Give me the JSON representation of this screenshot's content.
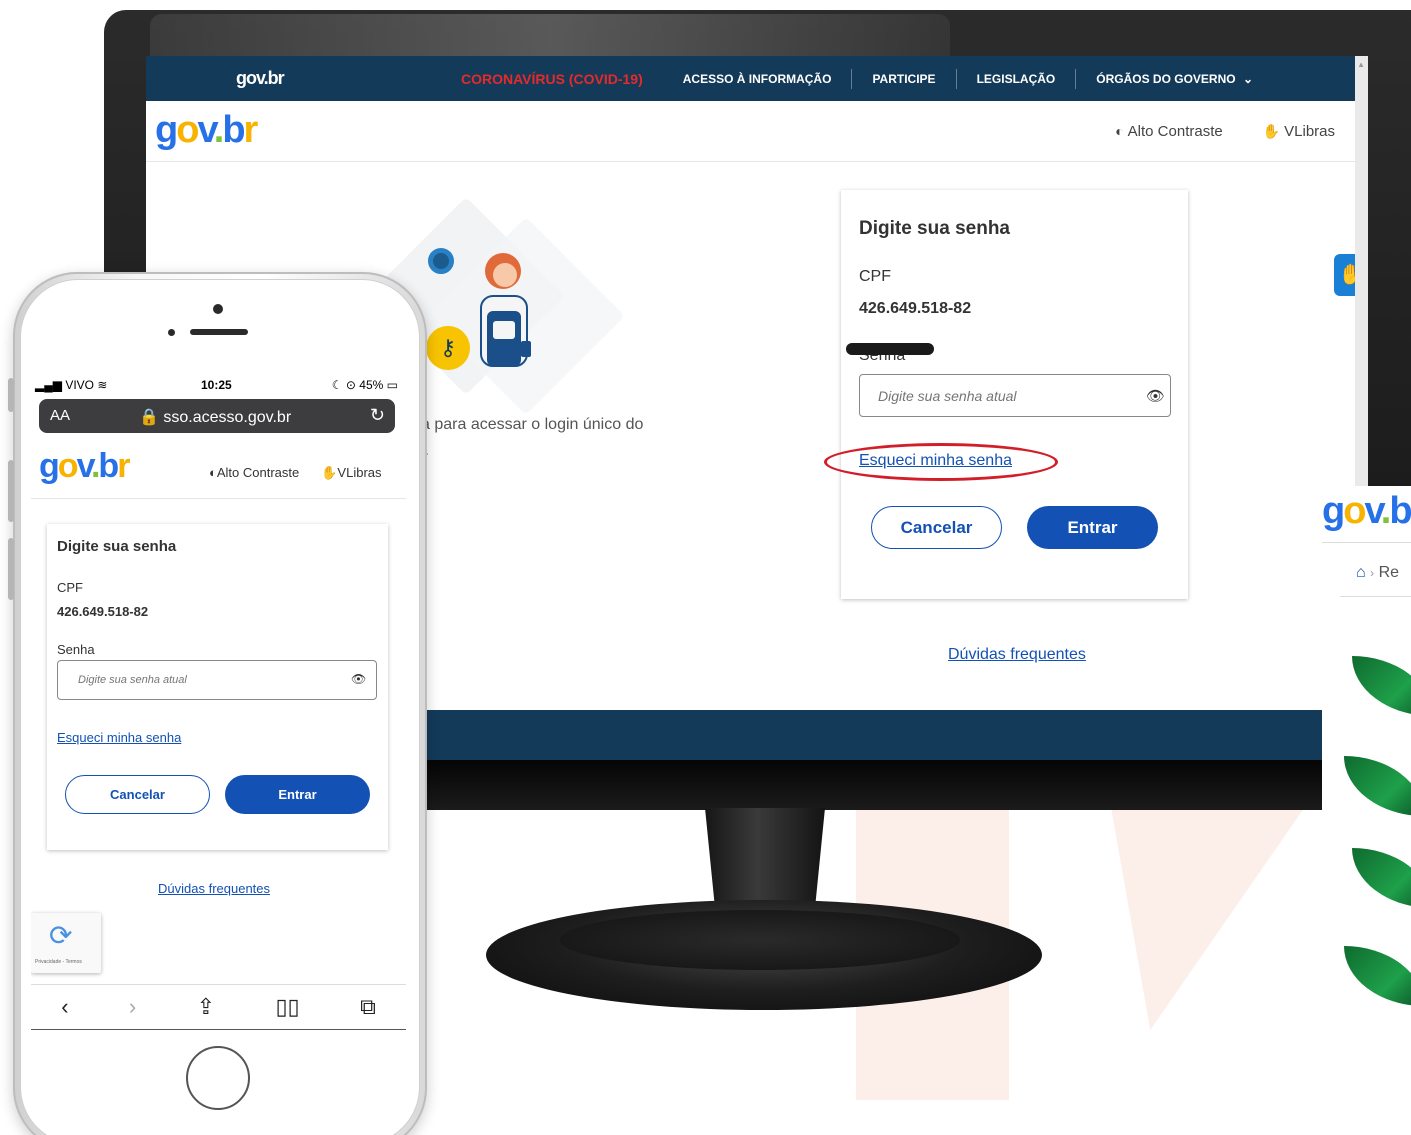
{
  "desktop": {
    "topbar": {
      "brand": "gov.br",
      "nav": [
        "CORONAVÍRUS (COVID-19)",
        "ACESSO À INFORMAÇÃO",
        "PARTICIPE",
        "LEGISLAÇÃO",
        "ÓRGÃOS DO GOVERNO"
      ],
      "dropdown_glyph": "⌄"
    },
    "header": {
      "logo": {
        "g": "g",
        "o": "o",
        "v": "v",
        "dot": ".",
        "b": "b",
        "r": "r"
      },
      "alto_contraste": "Alto Contraste",
      "vlibras": "VLibras"
    },
    "intro": {
      "line1": "a para acessar o login único do",
      "line2": "l."
    },
    "card": {
      "title": "Digite sua senha",
      "cpf_label": "CPF",
      "cpf_value": "426.649.518-82",
      "senha_label": "Senha",
      "password_placeholder": "Digite sua senha atual",
      "forgot": "Esqueci minha senha",
      "cancel": "Cancelar",
      "enter": "Entrar"
    },
    "faq": "Dúvidas frequentes"
  },
  "side_window": {
    "logo": {
      "g": "g",
      "o": "o",
      "v": "v",
      "dot": ".",
      "b": "b"
    },
    "breadcrumb_sep": "›",
    "breadcrumb": "Re"
  },
  "phone": {
    "status": {
      "carrier": "VIVO",
      "time": "10:25",
      "battery": "45%"
    },
    "url": "sso.acesso.gov.br",
    "aa": "AA",
    "header": {
      "logo": {
        "g": "g",
        "o": "o",
        "v": "v",
        "dot": ".",
        "b": "b",
        "r": "r"
      },
      "alto_contraste": "Alto Contraste",
      "vlibras": "VLibras"
    },
    "card": {
      "title": "Digite sua senha",
      "cpf_label": "CPF",
      "cpf_value": "426.649.518-82",
      "senha_label": "Senha",
      "password_placeholder": "Digite sua senha atual",
      "forgot": "Esqueci minha senha",
      "cancel": "Cancelar",
      "enter": "Entrar"
    },
    "faq": "Dúvidas frequentes",
    "recaptcha": "Privacidade - Termos"
  },
  "colors": {
    "navy": "#143a5a",
    "primary_blue": "#1351b4",
    "covid_red": "#e52a2a",
    "highlight_red": "#d21e28",
    "logo_blue": "#2670e8",
    "logo_yellow": "#f8b300",
    "logo_green": "#7ec13b"
  },
  "icons": [
    "contrast-icon",
    "vlibras-hand-icon",
    "eye-icon",
    "lock-icon",
    "reload-icon",
    "home-icon",
    "back-icon",
    "forward-icon",
    "share-icon",
    "bookmarks-icon",
    "tabs-icon",
    "recaptcha-icon",
    "key-icon"
  ]
}
